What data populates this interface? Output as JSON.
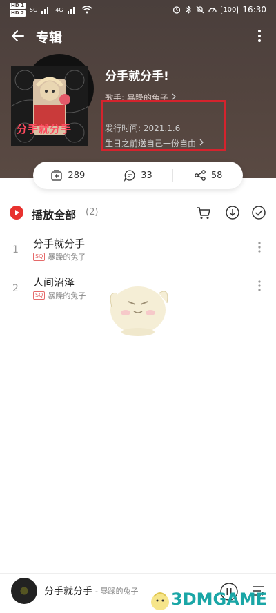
{
  "status_bar": {
    "time": "16:30",
    "battery": "100",
    "signal_labels": [
      "HD 1",
      "HD 2"
    ],
    "network": [
      "5G",
      "4G"
    ]
  },
  "header": {
    "title": "专辑"
  },
  "album": {
    "name": "分手就分手!",
    "singer_prefix": "歌手:",
    "singer": "暴躁的兔子",
    "release_label": "发行时间: 2021.1.6",
    "description": "生日之前送自己一份自由",
    "cover_text": "分手就分手"
  },
  "stats": {
    "collect": "289",
    "comments": "33",
    "shares": "58"
  },
  "playlist": {
    "play_all_label": "播放全部",
    "count": "(2)",
    "songs": [
      {
        "index": "1",
        "title": "分手就分手",
        "quality": "SQ",
        "artist": "暴躁的兔子"
      },
      {
        "index": "2",
        "title": "人间沼泽",
        "quality": "SQ",
        "artist": "暴躁的兔子"
      }
    ]
  },
  "mini_player": {
    "title": "分手就分手",
    "artist": "- 暴躁的兔子"
  },
  "watermark": {
    "text": "3DMGAME"
  },
  "colors": {
    "header_bg": "#4a3f3c",
    "accent_red": "#e8322f",
    "highlight_box": "#d4232d",
    "watermark": "#1aa6a6"
  }
}
